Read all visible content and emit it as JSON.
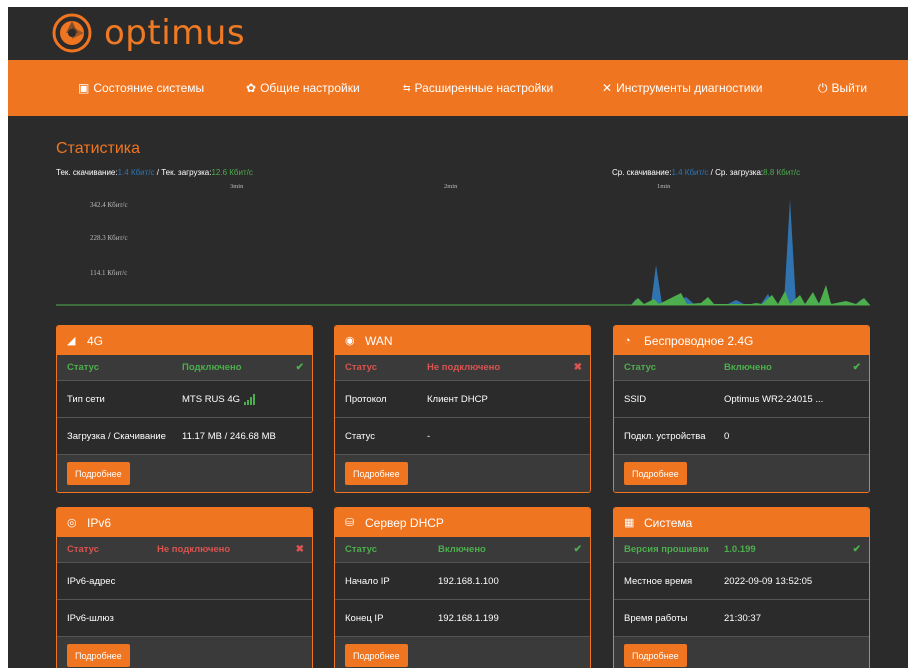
{
  "brand": {
    "name": "optimus",
    "color": "#f07521"
  },
  "nav": {
    "items": [
      {
        "icon": "monitor-icon",
        "label": "Состояние системы"
      },
      {
        "icon": "gear-icon",
        "label": "Общие настройки"
      },
      {
        "icon": "sliders-icon",
        "label": "Расширенные настройки"
      },
      {
        "icon": "tools-icon",
        "label": "Инструменты диагностики"
      },
      {
        "icon": "power-icon",
        "label": "Выйти"
      }
    ]
  },
  "stats": {
    "title": "Статистика",
    "cur_download_label": "Тек. скачивание:",
    "cur_download_value": "1.4 Кбит/с",
    "sep": " / ",
    "cur_upload_label": "Тек. загрузка:",
    "cur_upload_value": "12.6 Кбит/с",
    "avg_download_label": "Ср. скачивание:",
    "avg_download_value": "1.4 Кбит/с",
    "avg_upload_label": "Ср. загрузка:",
    "avg_upload_value": "8.8 Кбит/с",
    "time_ticks": [
      "3min",
      "2min",
      "1min"
    ],
    "y_labels": [
      "342.4 Кбит/с",
      "228.3 Кбит/с",
      "114.1 Кбит/с"
    ]
  },
  "colors": {
    "download": "#2f73b0",
    "upload": "#4cae4c",
    "status_ok": "#4cae4c",
    "status_err": "#d9534f"
  },
  "panels": {
    "lte": {
      "icon": "signal-icon",
      "title": "4G",
      "status_label": "Статус",
      "status_value": "Подключено",
      "rows": [
        {
          "label": "Тип сети",
          "value": "MTS RUS 4G"
        },
        {
          "label": "Загрузка / Скачивание",
          "value": "11.17 MB / 246.68 MB"
        }
      ],
      "button": "Подробнее"
    },
    "wan": {
      "icon": "globe-icon",
      "title": "WAN",
      "status_label": "Статус",
      "status_value": "Не подключено",
      "rows": [
        {
          "label": "Протокол",
          "value": "Клиент DHCP"
        },
        {
          "label": "Статус",
          "value": "-"
        }
      ],
      "button": "Подробнее"
    },
    "wifi": {
      "icon": "wifi-icon",
      "title": "Беспроводное 2.4G",
      "status_label": "Статус",
      "status_value": "Включено",
      "rows": [
        {
          "label": "SSID",
          "value": "Optimus WR2-24015 ..."
        },
        {
          "label": "Подкл. устройства",
          "value": "0"
        }
      ],
      "button": "Подробнее"
    },
    "ipv6": {
      "icon": "ipv6-icon",
      "title": "IPv6",
      "status_label": "Статус",
      "status_value": "Не подключено",
      "rows": [
        {
          "label": "IPv6-адрес",
          "value": ""
        },
        {
          "label": "IPv6-шлюз",
          "value": ""
        }
      ],
      "button": "Подробнее"
    },
    "dhcp": {
      "icon": "server-icon",
      "title": "Сервер DHCP",
      "status_label": "Статус",
      "status_value": "Включено",
      "rows": [
        {
          "label": "Начало IP",
          "value": "192.168.1.100"
        },
        {
          "label": "Конец IP",
          "value": "192.168.1.199"
        }
      ],
      "button": "Подробнее"
    },
    "system": {
      "icon": "system-icon",
      "title": "Система",
      "status_label": "Версия прошивки",
      "status_value": "1.0.199",
      "rows": [
        {
          "label": "Местное время",
          "value": "2022-09-09 13:52:05"
        },
        {
          "label": "Время работы",
          "value": "21:30:37"
        }
      ],
      "button": "Подробнее"
    }
  }
}
